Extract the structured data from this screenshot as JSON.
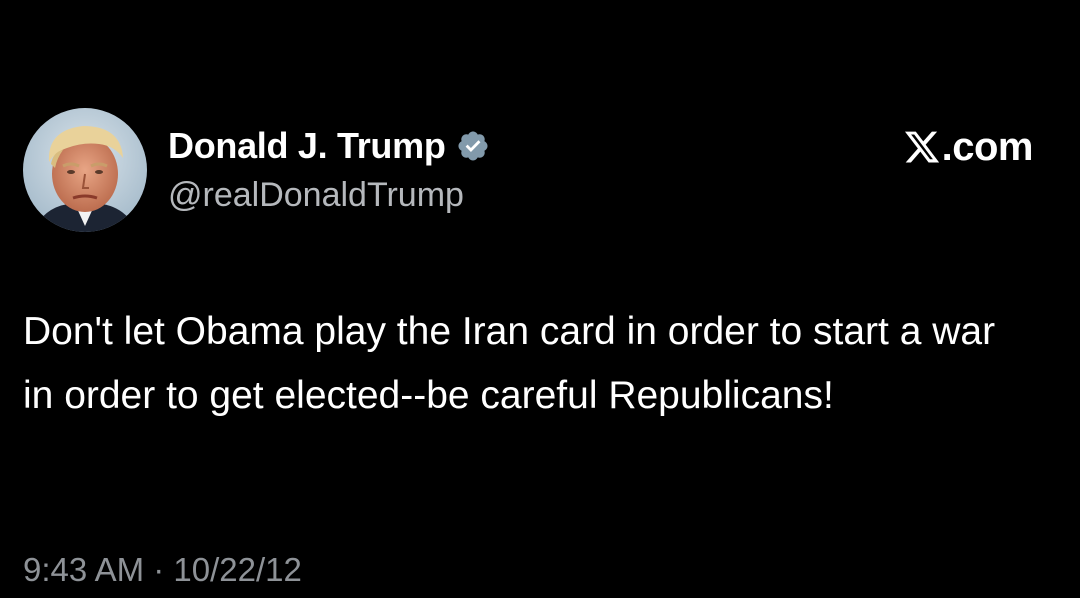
{
  "author": {
    "display_name": "Donald J. Trump",
    "handle": "@realDonaldTrump",
    "verified_icon": "verified-badge-icon",
    "avatar_icon": "profile-avatar"
  },
  "brand": {
    "logo_icon": "x-logo-icon",
    "label": ".com"
  },
  "tweet": {
    "text": "Don't let Obama play the Iran card in order to start a war in order to get elected--be careful Republicans!",
    "time": "9:43 AM",
    "separator": "·",
    "date": "10/22/12"
  },
  "colors": {
    "background": "#000000",
    "primary_text": "#ffffff",
    "secondary_text": "#8e9297",
    "verified": "#829aab"
  }
}
